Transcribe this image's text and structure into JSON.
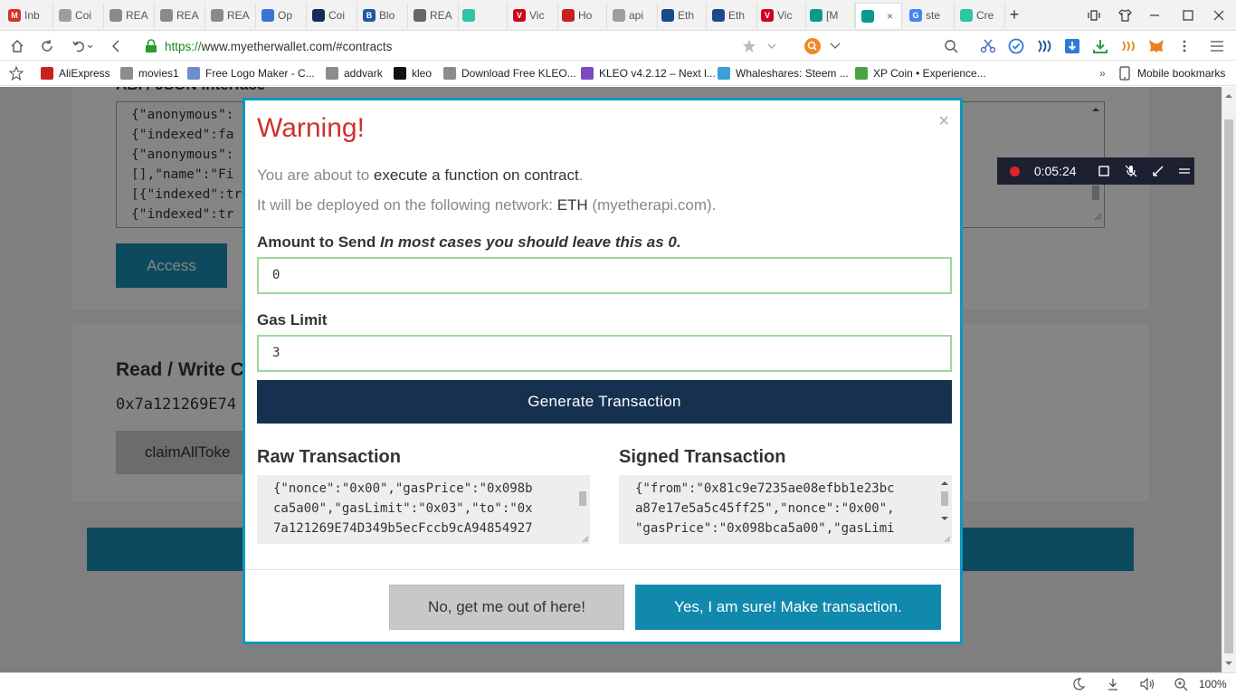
{
  "browser": {
    "tabs": [
      {
        "label": "Inb",
        "color": "#d93025",
        "glyph": "M"
      },
      {
        "label": "Coi",
        "color": "#9e9e9e",
        "glyph": ""
      },
      {
        "label": "REA",
        "color": "#8a8a8a",
        "glyph": ""
      },
      {
        "label": "REA",
        "color": "#8a8a8a",
        "glyph": ""
      },
      {
        "label": "REA",
        "color": "#8a8a8a",
        "glyph": ""
      },
      {
        "label": "Op",
        "color": "#3b73d6",
        "glyph": ""
      },
      {
        "label": "Coi",
        "color": "#1a2b5a",
        "glyph": ""
      },
      {
        "label": "Blo",
        "color": "#1f57a5",
        "glyph": "B"
      },
      {
        "label": "REA",
        "color": "#666666",
        "glyph": ""
      },
      {
        "label": "",
        "color": "#2ec4a5",
        "glyph": ""
      },
      {
        "label": "Vic",
        "color": "#d0021b",
        "glyph": "V"
      },
      {
        "label": "Ho",
        "color": "#c8201e",
        "glyph": ""
      },
      {
        "label": "api",
        "color": "#9e9e9e",
        "glyph": ""
      },
      {
        "label": "Eth",
        "color": "#1b4a8a",
        "glyph": ""
      },
      {
        "label": "Eth",
        "color": "#1b4a8a",
        "glyph": ""
      },
      {
        "label": "Vic",
        "color": "#d0021b",
        "glyph": "V"
      },
      {
        "label": "[M",
        "color": "#0a9b8f",
        "glyph": ""
      },
      {
        "label": "",
        "color": "#0a9b8f",
        "glyph": ""
      },
      {
        "label": "ste",
        "color": "#4285f4",
        "glyph": "G"
      },
      {
        "label": "Cre",
        "color": "#2ec4a5",
        "glyph": ""
      }
    ],
    "active_tab_close": "×",
    "new_tab": "+",
    "url_secure": "https://",
    "url_host": "www.myetherwallet.com",
    "url_path": "/#contracts",
    "bookmarks": [
      {
        "label": "AliExpress",
        "color": "#c9211e"
      },
      {
        "label": "movies1",
        "color": "#8c8c8c"
      },
      {
        "label": "Free Logo Maker - C...",
        "color": "#6d8fc9"
      },
      {
        "label": "addvark",
        "color": "#8c8c8c"
      },
      {
        "label": "kleo",
        "color": "#111111"
      },
      {
        "label": "Download Free KLEO...",
        "color": "#8c8c8c"
      },
      {
        "label": "KLEO v4.2.12 – Next l...",
        "color": "#7b4bc4"
      },
      {
        "label": "Whaleshares: Steem ...",
        "color": "#3aa0d8"
      },
      {
        "label": "XP Coin • Experience...",
        "color": "#4aa244"
      }
    ],
    "bookmarks_more": "»",
    "mobile_bookmarks": "Mobile bookmarks",
    "zoom": "100%"
  },
  "page": {
    "abi_label": "ABI / JSON Interface",
    "abi_lines": [
      "{\"anonymous\":",
      "{\"indexed\":fa",
      "{\"anonymous\":",
      "[],\"name\":\"Fi",
      "[{\"indexed\":tr",
      "{\"indexed\":tr"
    ],
    "access_button": "Access",
    "rw_title": "Read / Write C",
    "contract_address": "0x7a121269E74",
    "claim_button": "claimAllToke"
  },
  "recorder": {
    "time": "0:05:24"
  },
  "modal": {
    "title": "Warning!",
    "close": "×",
    "line1_prefix": "You are about to ",
    "line1_emphasis": "execute a function on contract",
    "line1_suffix": ".",
    "line2_prefix": "It will be deployed on the following network: ",
    "line2_network": "ETH",
    "line2_suffix": " (myetherapi.com).",
    "amount_label": "Amount to Send",
    "amount_hint": "In most cases you should leave this as 0.",
    "amount_value": "0",
    "gas_label": "Gas Limit",
    "gas_value": "3",
    "generate_button": "Generate Transaction",
    "raw_title": "Raw Transaction",
    "raw_lines": [
      "{\"nonce\":\"0x00\",\"gasPrice\":\"0x098b",
      "ca5a00\",\"gasLimit\":\"0x03\",\"to\":\"0x",
      "7a121269E74D349b5ecFccb9cA94854927"
    ],
    "signed_title": "Signed Transaction",
    "signed_lines": [
      "{\"from\":\"0x81c9e7235ae08efbb1e23bc",
      "a87e17e5a5c45ff25\",\"nonce\":\"0x00\",",
      "\"gasPrice\":\"0x098bca5a00\",\"gasLimi"
    ],
    "cancel_button": "No, get me out of here!",
    "confirm_button": "Yes, I am sure! Make transaction."
  }
}
